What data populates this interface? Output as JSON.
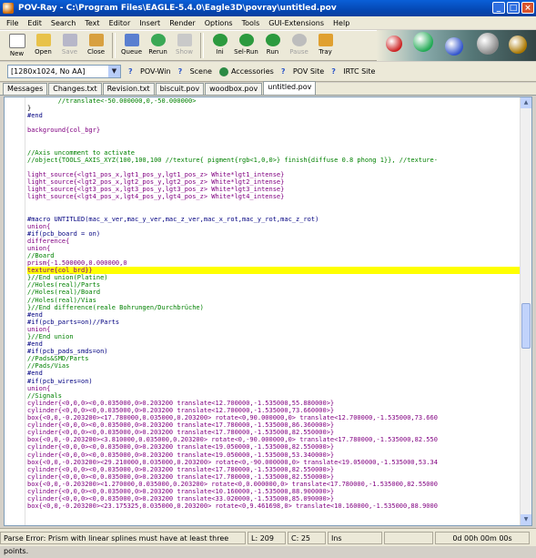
{
  "window": {
    "title": "POV-Ray - C:\\Program Files\\EAGLE-5.4.0\\Eagle3D\\povray\\untitled.pov"
  },
  "menu": [
    "File",
    "Edit",
    "Search",
    "Text",
    "Editor",
    "Insert",
    "Render",
    "Options",
    "Tools",
    "GUI-Extensions",
    "Help"
  ],
  "toolbar": {
    "buttons": [
      {
        "label": "New",
        "icon": "new-file-icon",
        "enabled": true
      },
      {
        "label": "Open",
        "icon": "open-folder-icon",
        "enabled": true
      },
      {
        "label": "Save",
        "icon": "save-icon",
        "enabled": false
      },
      {
        "label": "Close",
        "icon": "close-file-icon",
        "enabled": true
      },
      {
        "label": "Queue",
        "icon": "queue-icon",
        "enabled": true
      },
      {
        "label": "Rerun",
        "icon": "rerun-icon",
        "enabled": true
      },
      {
        "label": "Show",
        "icon": "show-icon",
        "enabled": false
      },
      {
        "label": "Ini",
        "icon": "ini-icon",
        "enabled": true
      },
      {
        "label": "Sel-Run",
        "icon": "sel-run-icon",
        "enabled": true
      },
      {
        "label": "Run",
        "icon": "run-icon",
        "enabled": true
      },
      {
        "label": "Pause",
        "icon": "pause-icon",
        "enabled": false
      },
      {
        "label": "Tray",
        "icon": "tray-icon",
        "enabled": true
      }
    ]
  },
  "toolbar2": {
    "resolution": "[1280x1024, No AA]",
    "buttons": [
      "POV-Win",
      "Scene",
      "Accessories",
      "POV Site",
      "IRTC Site"
    ]
  },
  "tabs": [
    {
      "label": "Messages",
      "active": false
    },
    {
      "label": "Changes.txt",
      "active": false
    },
    {
      "label": "Revision.txt",
      "active": false
    },
    {
      "label": "biscuit.pov",
      "active": false
    },
    {
      "label": "woodbox.pov",
      "active": false
    },
    {
      "label": "untitled.pov",
      "active": true
    }
  ],
  "editor": {
    "lines": [
      {
        "t": "        //translate<-50.000000,0,-50.000000>",
        "c": "comment"
      },
      {
        "t": "}",
        "c": "text"
      },
      {
        "t": "#end",
        "c": "dir"
      },
      {
        "t": "",
        "c": "text"
      },
      {
        "t": "background{col_bgr}",
        "c": "kw"
      },
      {
        "t": "",
        "c": "text"
      },
      {
        "t": "",
        "c": "text"
      },
      {
        "t": "//Axis uncomment to activate",
        "c": "comment"
      },
      {
        "t": "//object{TOOLS_AXIS_XYZ(100,100,100 //texture{ pigment{rgb<1,0,0>} finish{diffuse 0.8 phong 1}}, //texture-",
        "c": "comment"
      },
      {
        "t": "",
        "c": "text"
      },
      {
        "t": "light_source{<lgt1_pos_x,lgt1_pos_y,lgt1_pos_z> White*lgt1_intense}",
        "c": "kw"
      },
      {
        "t": "light_source{<lgt2_pos_x,lgt2_pos_y,lgt2_pos_z> White*lgt2_intense}",
        "c": "kw"
      },
      {
        "t": "light_source{<lgt3_pos_x,lgt3_pos_y,lgt3_pos_z> White*lgt3_intense}",
        "c": "kw"
      },
      {
        "t": "light_source{<lgt4_pos_x,lgt4_pos_y,lgt4_pos_z> White*lgt4_intense}",
        "c": "kw"
      },
      {
        "t": "",
        "c": "text"
      },
      {
        "t": "",
        "c": "text"
      },
      {
        "t": "#macro UNTITLED(mac_x_ver,mac_y_ver,mac_z_ver,mac_x_rot,mac_y_rot,mac_z_rot)",
        "c": "dir"
      },
      {
        "t": "union{",
        "c": "kw"
      },
      {
        "t": "#if(pcb_board = on)",
        "c": "dir"
      },
      {
        "t": "difference{",
        "c": "kw"
      },
      {
        "t": "union{",
        "c": "kw"
      },
      {
        "t": "//Board",
        "c": "comment"
      },
      {
        "t": "prism{-1.500000,0.000000,0",
        "c": "kw"
      },
      {
        "t": "texture{col_brd}}",
        "c": "kw",
        "hl": true
      },
      {
        "t": "}//End union(Platine)",
        "c": "comment"
      },
      {
        "t": "//Holes(real)/Parts",
        "c": "comment"
      },
      {
        "t": "//Holes(real)/Board",
        "c": "comment"
      },
      {
        "t": "//Holes(real)/Vias",
        "c": "comment"
      },
      {
        "t": "}//End difference(reale Bohrungen/Durchbrüche)",
        "c": "comment"
      },
      {
        "t": "#end",
        "c": "dir"
      },
      {
        "t": "#if(pcb_parts=on)//Parts",
        "c": "dir"
      },
      {
        "t": "union{",
        "c": "kw"
      },
      {
        "t": "}//End union",
        "c": "comment"
      },
      {
        "t": "#end",
        "c": "dir"
      },
      {
        "t": "#if(pcb_pads_smds=on)",
        "c": "dir"
      },
      {
        "t": "//Pads&SMD/Parts",
        "c": "comment"
      },
      {
        "t": "//Pads/Vias",
        "c": "comment"
      },
      {
        "t": "#end",
        "c": "dir"
      },
      {
        "t": "#if(pcb_wires=on)",
        "c": "dir"
      },
      {
        "t": "union{",
        "c": "kw"
      },
      {
        "t": "//Signals",
        "c": "comment"
      },
      {
        "t": "cylinder{<0,0,0><0,0.035000,0>0.203200 translate<12.700000,-1.535000,55.880000>}",
        "c": "kw"
      },
      {
        "t": "cylinder{<0,0,0><0,0.035000,0>0.203200 translate<12.700000,-1.535000,73.660000>}",
        "c": "kw"
      },
      {
        "t": "box{<0,0,-0.203200><17.780000,0.035000,0.203200> rotate<0,90.000000,0> translate<12.700000,-1.535000,73.660",
        "c": "kw"
      },
      {
        "t": "cylinder{<0,0,0><0,0.035000,0>0.203200 translate<17.780000,-1.535000,86.360000>}",
        "c": "kw"
      },
      {
        "t": "cylinder{<0,0,0><0,0.035000,0>0.203200 translate<17.780000,-1.535000,82.550000>}",
        "c": "kw"
      },
      {
        "t": "box{<0,0,-0.203200><3.810000,0.035000,0.203200> rotate<0,-90.000000,0> translate<17.780000,-1.535000,82.550",
        "c": "kw"
      },
      {
        "t": "cylinder{<0,0,0><0,0.035000,0>0.203200 translate<19.050000,-1.535000,82.550000>}",
        "c": "kw"
      },
      {
        "t": "cylinder{<0,0,0><0,0.035000,0>0.203200 translate<19.050000,-1.535000,53.340000>}",
        "c": "kw"
      },
      {
        "t": "box{<0,0,-0.203200><29.210000,0.035000,0.203200> rotate<0,-90.000000,0> translate<19.050000,-1.535000,53.34",
        "c": "kw"
      },
      {
        "t": "cylinder{<0,0,0><0,0.035000,0>0.203200 translate<17.780000,-1.535000,82.550000>}",
        "c": "kw"
      },
      {
        "t": "cylinder{<0,0,0><0,0.035000,0>0.203200 translate<17.780000,-1.535000,82.550000>}",
        "c": "kw"
      },
      {
        "t": "box{<0,0,-0.203200><1.270000,0.035000,0.203200> rotate<0,0.000000,0> translate<17.780000,-1.535000,82.55000",
        "c": "kw"
      },
      {
        "t": "cylinder{<0,0,0><0,0.035000,0>0.203200 translate<10.160000,-1.535000,88.900000>}",
        "c": "kw"
      },
      {
        "t": "cylinder{<0,0,0><0,0.035000,0>0.203200 translate<33.020000,-1.535000,85.090000>}",
        "c": "kw"
      },
      {
        "t": "box{<0,0,-0.203200><23.175325,0.035000,0.203200> rotate<0,9.461698,0> translate<10.160000,-1.535000,88.9000",
        "c": "kw"
      }
    ]
  },
  "status": {
    "message": "Parse Error: Prism with linear splines must have at least three points.",
    "line": "L: 209",
    "col": "C: 25",
    "mode": "Ins",
    "time": "0d 00h 00m 00s"
  }
}
